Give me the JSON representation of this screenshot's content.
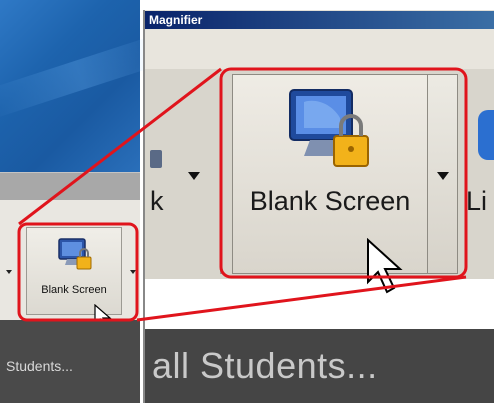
{
  "magnifier": {
    "title": "Magnifier",
    "button_label": "Blank Screen",
    "partial_left_label": "k",
    "partial_right_label": "Li",
    "footer_text": "all Students..."
  },
  "small_view": {
    "button_label": "Blank Screen",
    "footer_text": "Students..."
  },
  "colors": {
    "callout": "#e0141c",
    "title_bar": "#0a246a"
  },
  "icons": {
    "blank_screen": "monitor-with-padlock-icon",
    "cursor": "mouse-pointer-icon",
    "dropdown": "dropdown-arrow-icon"
  }
}
